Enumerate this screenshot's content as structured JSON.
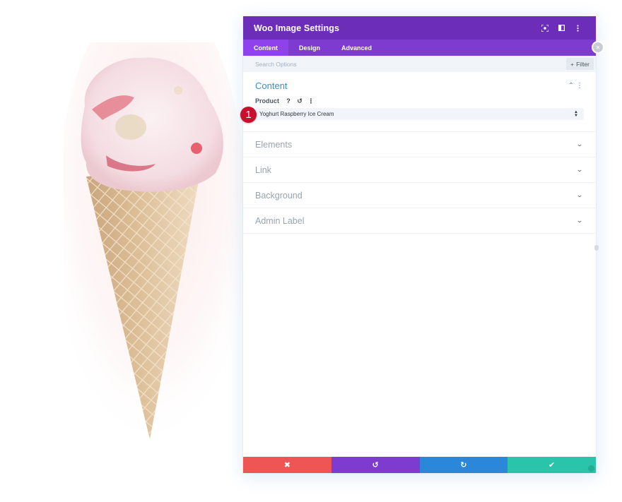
{
  "panel": {
    "title": "Woo Image Settings",
    "header_icons": [
      "focus-icon",
      "sidebar-toggle-icon",
      "more-options-icon"
    ],
    "tabs": [
      {
        "label": "Content",
        "active": true
      },
      {
        "label": "Design",
        "active": false
      },
      {
        "label": "Advanced",
        "active": false
      }
    ],
    "search": {
      "placeholder": "Search Options"
    },
    "filter_label": "Filter"
  },
  "content_section": {
    "title": "Content",
    "field": {
      "label": "Product",
      "value": "Yoghurt Raspberry Ice Cream"
    },
    "badge_number": "1"
  },
  "sections": [
    {
      "title": "Elements"
    },
    {
      "title": "Link"
    },
    {
      "title": "Background"
    },
    {
      "title": "Admin Label"
    }
  ],
  "footer": {
    "buttons": [
      {
        "name": "cancel",
        "icon": "close-icon",
        "color": "#ef5555"
      },
      {
        "name": "undo",
        "icon": "undo-icon",
        "color": "#7e3bd0"
      },
      {
        "name": "redo",
        "icon": "redo-icon",
        "color": "#2b87da"
      },
      {
        "name": "save",
        "icon": "check-icon",
        "color": "#29c4a9"
      }
    ]
  },
  "colors": {
    "header": "#6c2eb9",
    "tabs": "#7e3bd0",
    "active_tab": "#8f42ec",
    "section_title": "#3a8fc7",
    "badge": "#c8102e"
  },
  "image": {
    "subject": "raspberry ice cream in waffle cone"
  }
}
